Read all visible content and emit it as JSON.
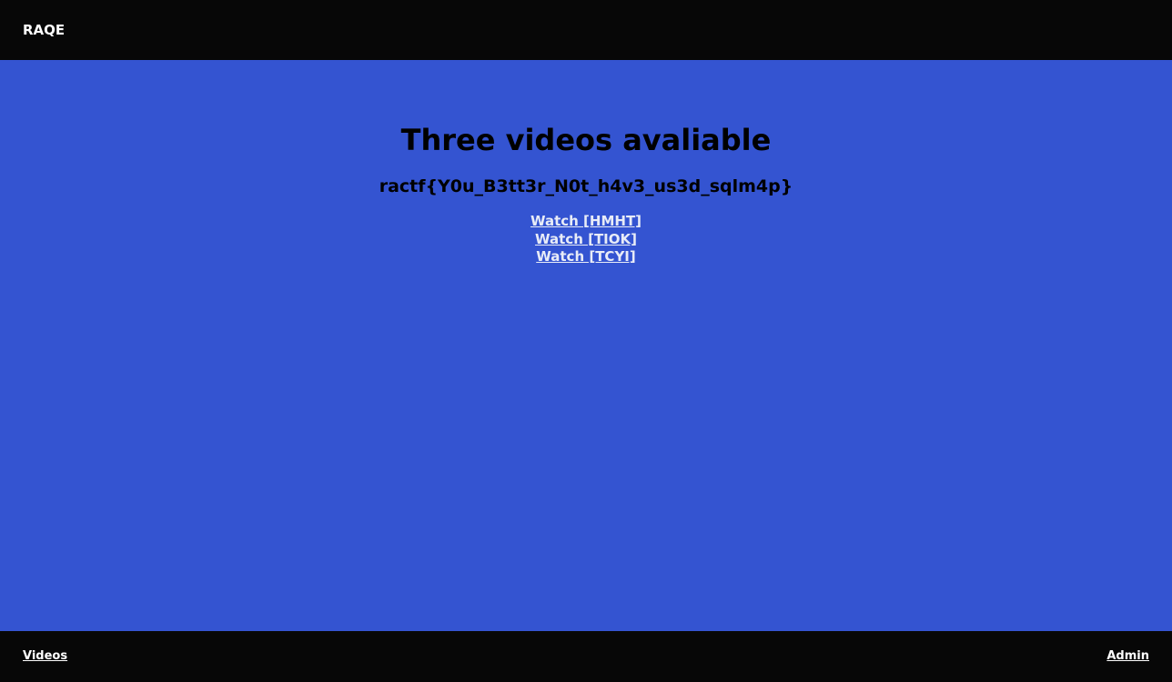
{
  "header": {
    "brand": "RAQE"
  },
  "main": {
    "title": "Three videos avaliable",
    "flag": "ractf{Y0u_B3tt3r_N0t_h4v3_us3d_sqlm4p}",
    "videos": [
      {
        "label": "Watch [HMHT]"
      },
      {
        "label": "Watch [TIOK]"
      },
      {
        "label": "Watch [TCYI]"
      }
    ]
  },
  "footer": {
    "left_link": "Videos",
    "right_link": "Admin"
  },
  "colors": {
    "bar_background": "#070707",
    "page_background": "#3454d1",
    "link_color": "#e8ecf7"
  }
}
